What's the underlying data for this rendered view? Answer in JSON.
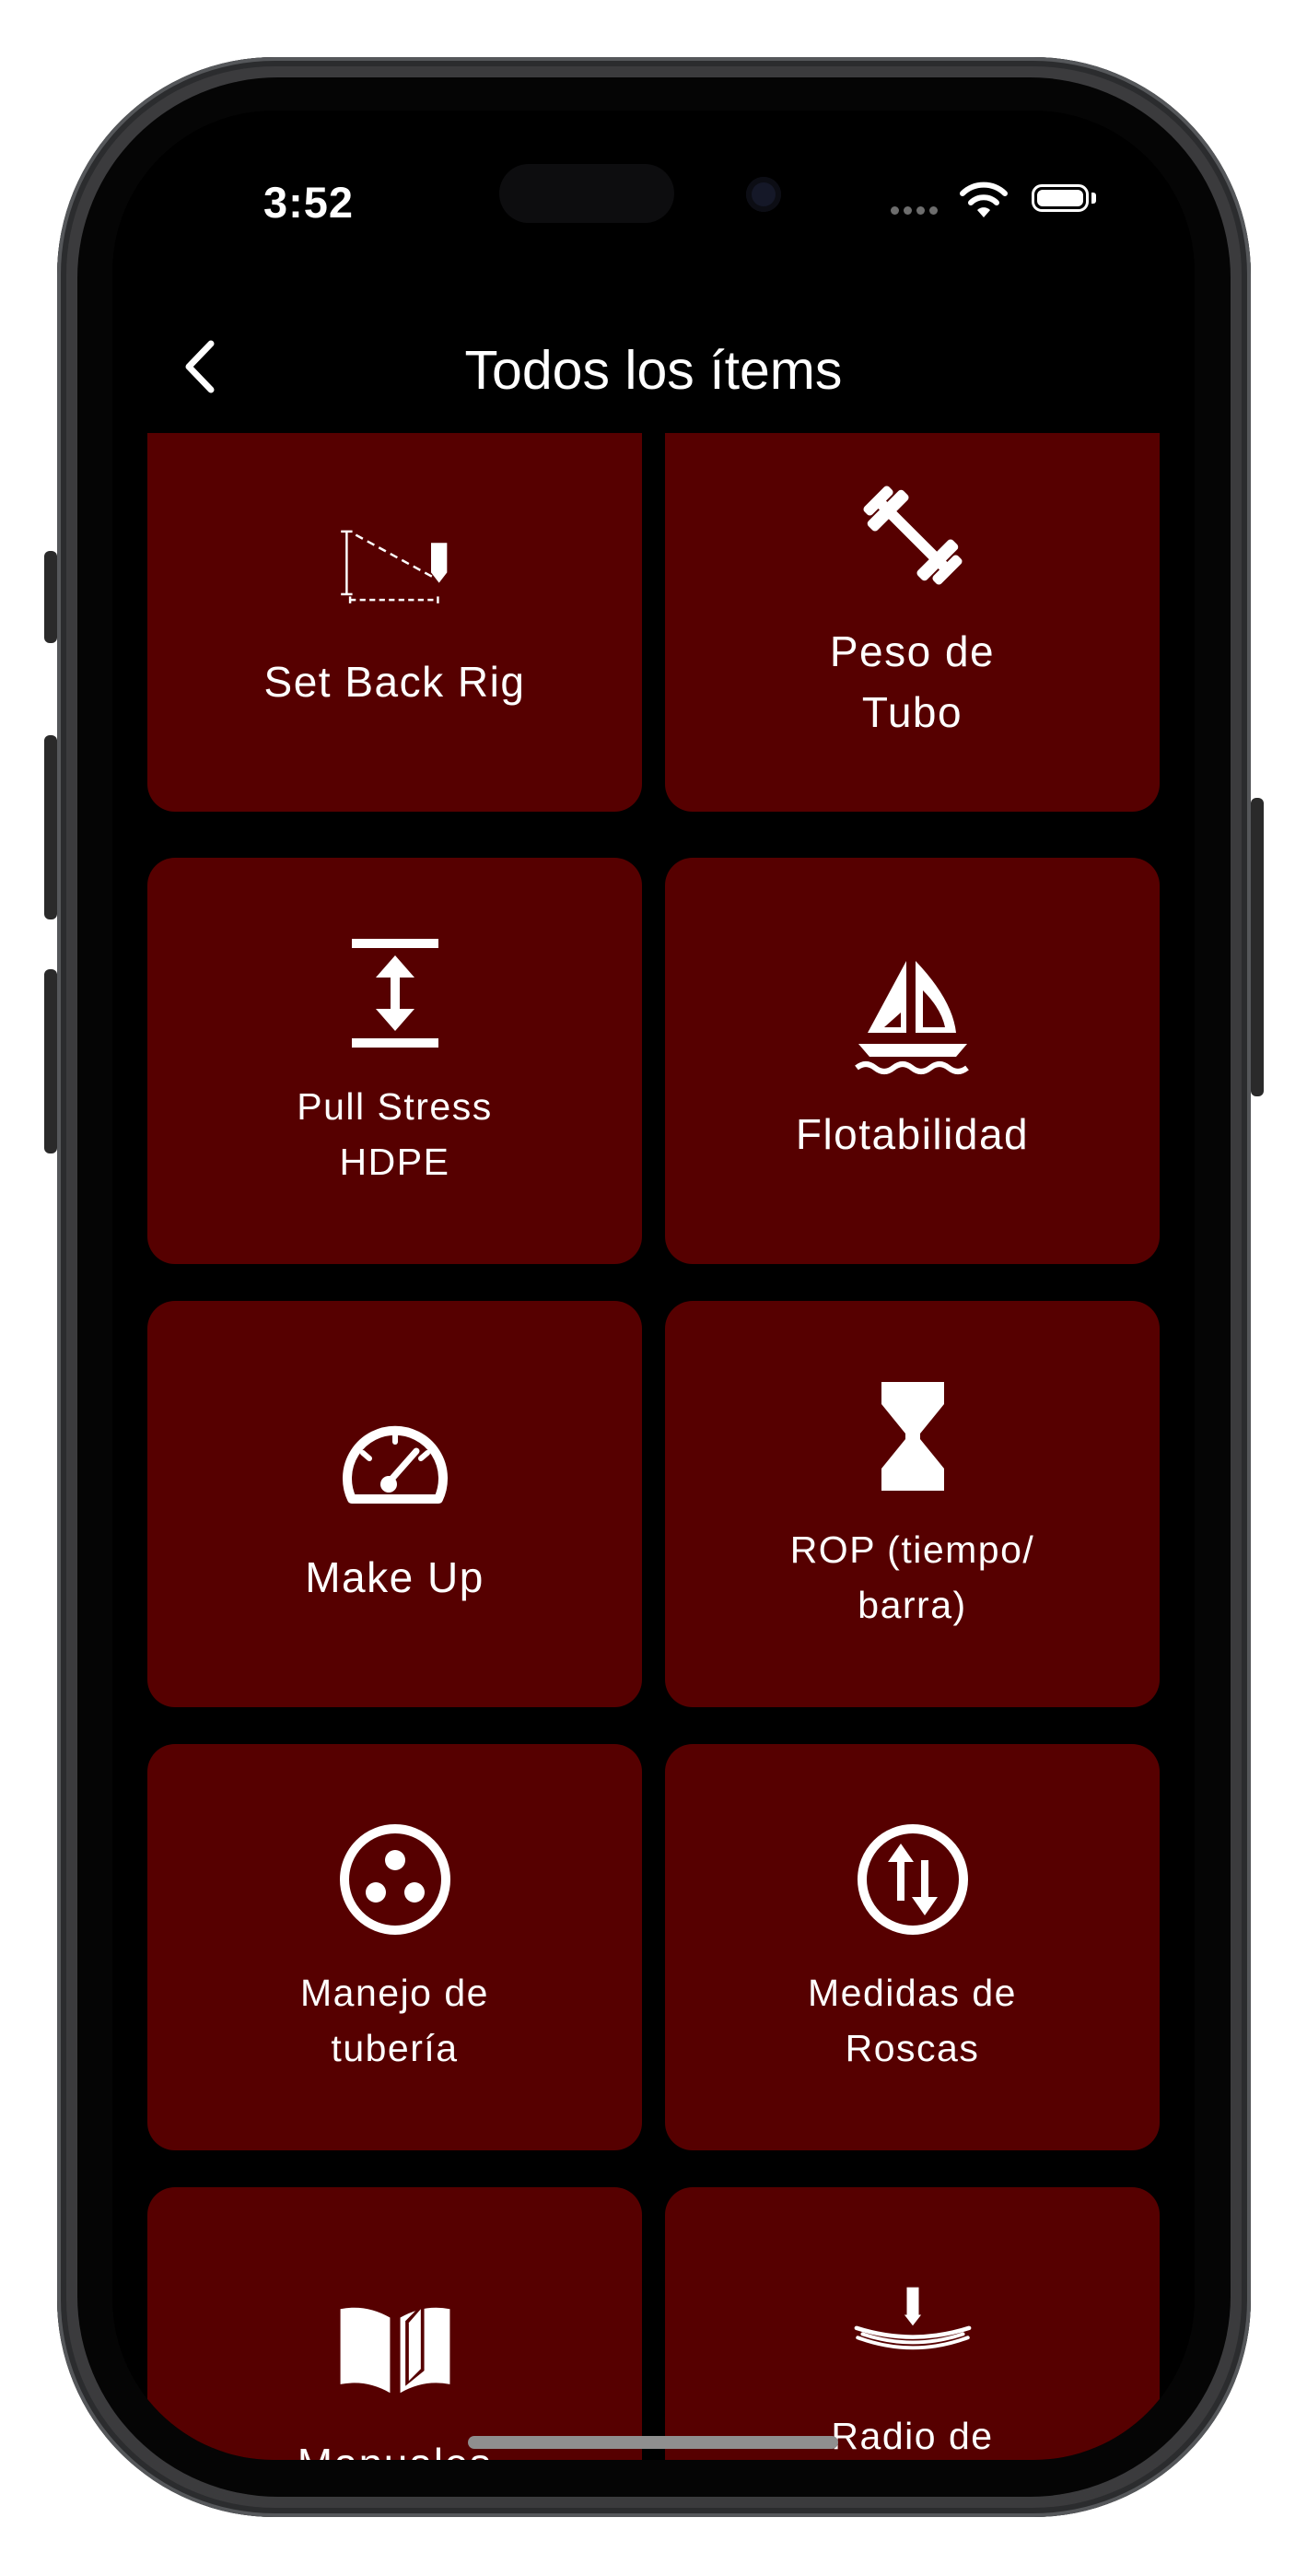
{
  "status_bar": {
    "time": "3:52"
  },
  "nav": {
    "title": "Todos los ítems"
  },
  "colors": {
    "tile_background": "#560000",
    "screen_background": "#000000",
    "text": "#ffffff"
  },
  "tiles": [
    {
      "label": "Set Back Rig",
      "icon": "setback-rig-icon"
    },
    {
      "label": "Peso de\nTubo",
      "icon": "barbell-icon"
    },
    {
      "label": "Pull Stress\nHDPE",
      "icon": "vertical-stretch-icon"
    },
    {
      "label": "Flotabilidad",
      "icon": "sailboat-icon"
    },
    {
      "label": "Make Up",
      "icon": "gauge-icon"
    },
    {
      "label": "ROP (tiempo/\nbarra)",
      "icon": "hourglass-icon"
    },
    {
      "label": "Manejo de\ntubería",
      "icon": "pipe-circle-icon"
    },
    {
      "label": "Medidas de\nRoscas",
      "icon": "swap-arrows-icon"
    },
    {
      "label": "Manuales",
      "icon": "open-book-icon"
    },
    {
      "label": "Radio de\nCurvatura",
      "icon": "bend-radius-icon"
    }
  ]
}
